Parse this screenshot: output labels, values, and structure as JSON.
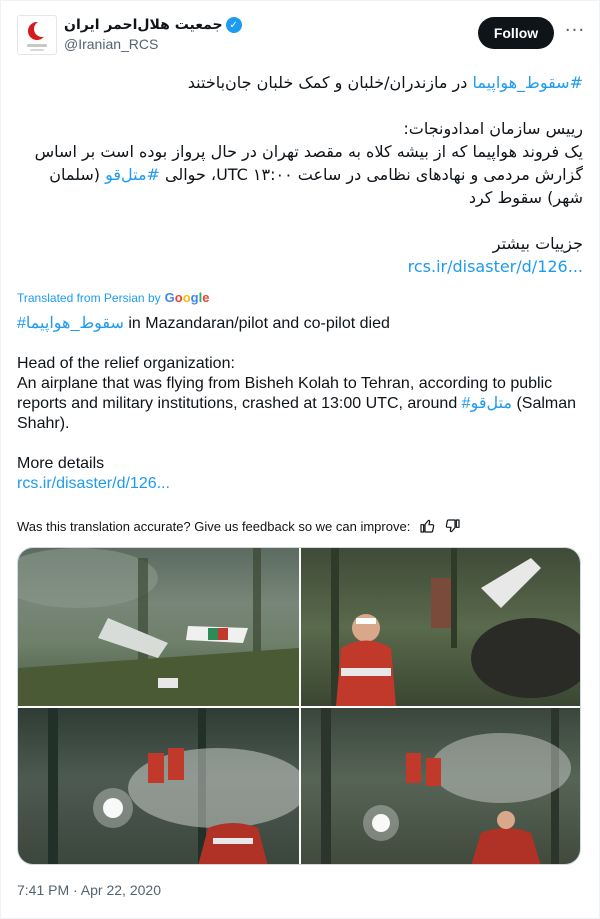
{
  "author": {
    "display_name": "جمعیت هلال‌احمر ایران",
    "handle": "@Iranian_RCS",
    "verified_icon": "verified-badge-icon",
    "avatar": "red-crescent-logo"
  },
  "actions": {
    "follow_label": "Follow",
    "more_label": "···"
  },
  "tweet_fa": {
    "line1_hashtag": "#سقوط_هواپیما",
    "line1_text": " در مازندران/خلبان و کمک خلبان جان‌باختند",
    "para2_head": "رییس سازمان امدادونجات:",
    "para2_text_a": "یک فروند هواپیما که از بیشه کلاه به مقصد تهران در حال پرواز بوده است بر اساس گزارش مردمی و نهادهای نظامی در ساعت ۱۳:۰۰ UTC، حوالی ",
    "para2_hashtag": "#متل‌قو",
    "para2_text_b": " (سلمان شهر) سقوط کرد",
    "more_details": "جزییات بیشتر",
    "link": "rcs.ir/disaster/d/126..."
  },
  "translation": {
    "label": "Translated from Persian by",
    "provider": "Google",
    "line1_hashtag": "#سقوط_هواپیما",
    "line1_text": " in Mazandaran/pilot and co-pilot died",
    "para2_head": "Head of the relief organization:",
    "para2_text_a": "An airplane that was flying from Bisheh Kolah to Tehran, according to public reports and military institutions, crashed at 13:00 UTC, around ",
    "para2_hashtag": "#متل‌قو",
    "para2_text_b": " (Salman Shahr).",
    "more_details": "More details",
    "link": "rcs.ir/disaster/d/126..."
  },
  "feedback": {
    "question": "Was this translation accurate? Give us feedback so we can improve:",
    "thumbs_up_icon": "thumbs-up-icon",
    "thumbs_down_icon": "thumbs-down-icon"
  },
  "media": {
    "count": 4,
    "photos": [
      "plane-wreck-in-forest",
      "rescuer-at-wreck",
      "rescuers-with-smoke",
      "rescuers-with-flashlight"
    ]
  },
  "timestamp": "7:41 PM · Apr 22, 2020",
  "colors": {
    "link": "#1d9bf0",
    "text": "#0f1419",
    "muted": "#536471",
    "button": "#0f1419"
  }
}
